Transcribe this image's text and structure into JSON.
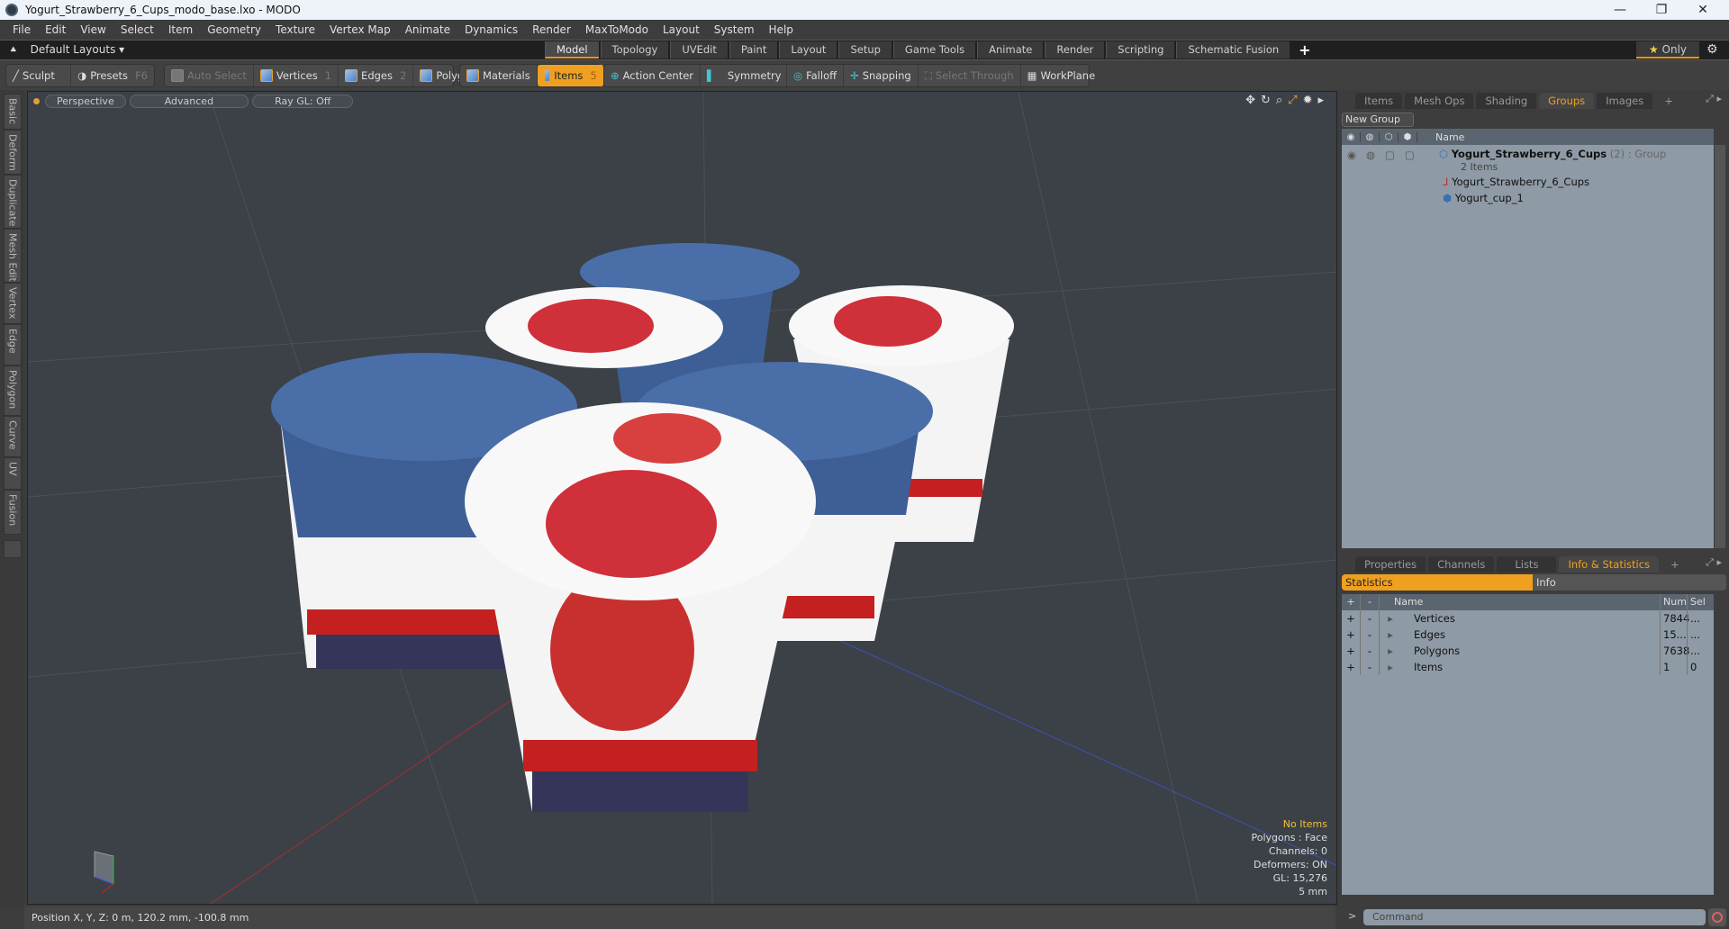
{
  "window": {
    "title": "Yogurt_Strawberry_6_Cups_modo_base.lxo - MODO",
    "minimize": "—",
    "restore": "❐",
    "close": "✕"
  },
  "menu": [
    "File",
    "Edit",
    "View",
    "Select",
    "Item",
    "Geometry",
    "Texture",
    "Vertex Map",
    "Animate",
    "Dynamics",
    "Render",
    "MaxToModo",
    "Layout",
    "System",
    "Help"
  ],
  "layoutbar": {
    "default_layouts": "Default Layouts ▾",
    "tabs": [
      "Model",
      "Topology",
      "UVEdit",
      "Paint",
      "Layout",
      "Setup",
      "Game Tools",
      "Animate",
      "Render",
      "Scripting",
      "Schematic Fusion"
    ],
    "active_tab": "Model",
    "add": "+",
    "only": "Only",
    "star": "★",
    "gear": "⚙"
  },
  "toolbar": {
    "sculpt": "Sculpt",
    "presets": "Presets",
    "presets_key": "F6",
    "auto_select": "Auto Select",
    "vertices": "Vertices",
    "vertices_key": "1",
    "edges": "Edges",
    "edges_key": "2",
    "polygons": "Polygons",
    "materials": "Materials",
    "items": "Items",
    "items_key": "5",
    "action_center": "Action Center",
    "symmetry": "Symmetry",
    "falloff": "Falloff",
    "snapping": "Snapping",
    "select_through": "Select Through",
    "workplane": "WorkPlane"
  },
  "left_tabs": [
    "Basic",
    "Deform",
    "Duplicate",
    "Mesh Edit",
    "Vertex",
    "Edge",
    "Polygon",
    "Curve",
    "UV",
    "Fusion"
  ],
  "viewport": {
    "view": "Perspective",
    "shading": "Advanced",
    "raygl": "Ray GL: Off",
    "icons": [
      "move-icon",
      "rotate-icon",
      "zoom-icon",
      "maximize-icon",
      "settings-icon",
      "more-icon"
    ],
    "hud": {
      "selection": "No Items",
      "polygons": "Polygons : Face",
      "channels": "Channels: 0",
      "deformers": "Deformers: ON",
      "gl": "GL: 15,276",
      "unit": "5 mm"
    }
  },
  "status": {
    "position": "Position X, Y, Z:   0 m, 120.2 mm, -100.8 mm"
  },
  "groups_panel": {
    "tabs": [
      "Items",
      "Mesh Ops",
      "Shading",
      "Groups",
      "Images"
    ],
    "active_tab": "Groups",
    "new_group": "New Group",
    "name_header": "Name",
    "group": {
      "name": "Yogurt_Strawberry_6_Cups",
      "count": "(2)",
      "type": ": Group",
      "sub": "2 Items"
    },
    "children": [
      "Yogurt_Strawberry_6_Cups",
      "Yogurt_cup_1"
    ]
  },
  "info_panel": {
    "tabs": [
      "Properties",
      "Channels",
      "Lists",
      "Info & Statistics"
    ],
    "active_tab": "Info & Statistics",
    "subtabs": [
      "Statistics",
      "Info"
    ],
    "headers": {
      "plus": "+",
      "minus": "-",
      "name": "Name",
      "num": "Num",
      "sel": "Sel"
    },
    "rows": [
      {
        "name": "Vertices",
        "num": "7844",
        "sel": "..."
      },
      {
        "name": "Edges",
        "num": "15...",
        "sel": "..."
      },
      {
        "name": "Polygons",
        "num": "7638",
        "sel": "..."
      },
      {
        "name": "Items",
        "num": "1",
        "sel": "0"
      }
    ]
  },
  "command": {
    "prompt": ">",
    "placeholder": "Command"
  }
}
